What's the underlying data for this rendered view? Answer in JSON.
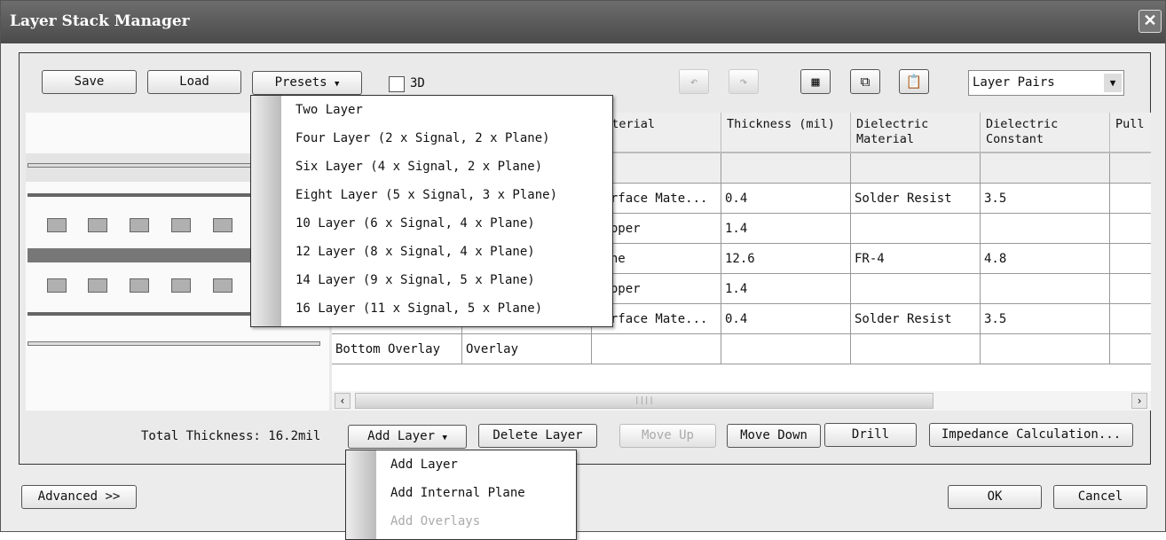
{
  "window": {
    "title": "Layer Stack Manager",
    "close": "✕"
  },
  "toolbar": {
    "save": "Save",
    "load": "Load",
    "presets": "Presets",
    "checkbox_3d": "3D",
    "checkbox_3d_checked": false,
    "view_select": "Layer Pairs",
    "icons": [
      "undo-icon",
      "redo-icon",
      "properties-icon",
      "copy-icon",
      "paste-icon"
    ]
  },
  "presets_menu": [
    "Two Layer",
    "Four Layer (2 x Signal, 2 x Plane)",
    "Six Layer (4 x Signal, 2 x Plane)",
    "Eight Layer (5 x Signal, 3 x Plane)",
    "10 Layer (6 x Signal, 4 x Plane)",
    "12 Layer (8 x Signal, 4 x Plane)",
    "14 Layer (9 x Signal, 5 x Plane)",
    "16 Layer (11 x Signal, 5 x Plane)"
  ],
  "grid": {
    "headers": [
      "",
      "",
      "Material",
      "Thickness (mil)",
      "Dielectric Material",
      "Dielectric Constant",
      "Pull"
    ],
    "rows": [
      [
        "",
        "",
        "",
        "",
        "",
        "",
        ""
      ],
      [
        "",
        "",
        "Surface Mate...",
        "0.4",
        "Solder Resist",
        "3.5",
        ""
      ],
      [
        "",
        "",
        "Copper",
        "1.4",
        "",
        "",
        ""
      ],
      [
        "",
        "",
        "None",
        "12.6",
        "FR-4",
        "4.8",
        ""
      ],
      [
        "",
        "",
        "Copper",
        "1.4",
        "",
        "",
        ""
      ],
      [
        "",
        "",
        "Surface Mate...",
        "0.4",
        "Solder Resist",
        "3.5",
        ""
      ],
      [
        "Bottom Overlay",
        "Overlay",
        "",
        "",
        "",
        "",
        ""
      ]
    ]
  },
  "footer": {
    "total_thickness": "Total Thickness: 16.2mil",
    "add_layer": "Add Layer",
    "delete_layer": "Delete Layer",
    "move_up": "Move Up",
    "move_down": "Move Down",
    "drill": "Drill",
    "impedance": "Impedance Calculation...",
    "advanced": "Advanced >>",
    "ok": "OK",
    "cancel": "Cancel"
  },
  "add_layer_menu": [
    {
      "label": "Add Layer",
      "enabled": true
    },
    {
      "label": "Add Internal Plane",
      "enabled": true
    },
    {
      "label": "Add Overlays",
      "enabled": false
    }
  ]
}
